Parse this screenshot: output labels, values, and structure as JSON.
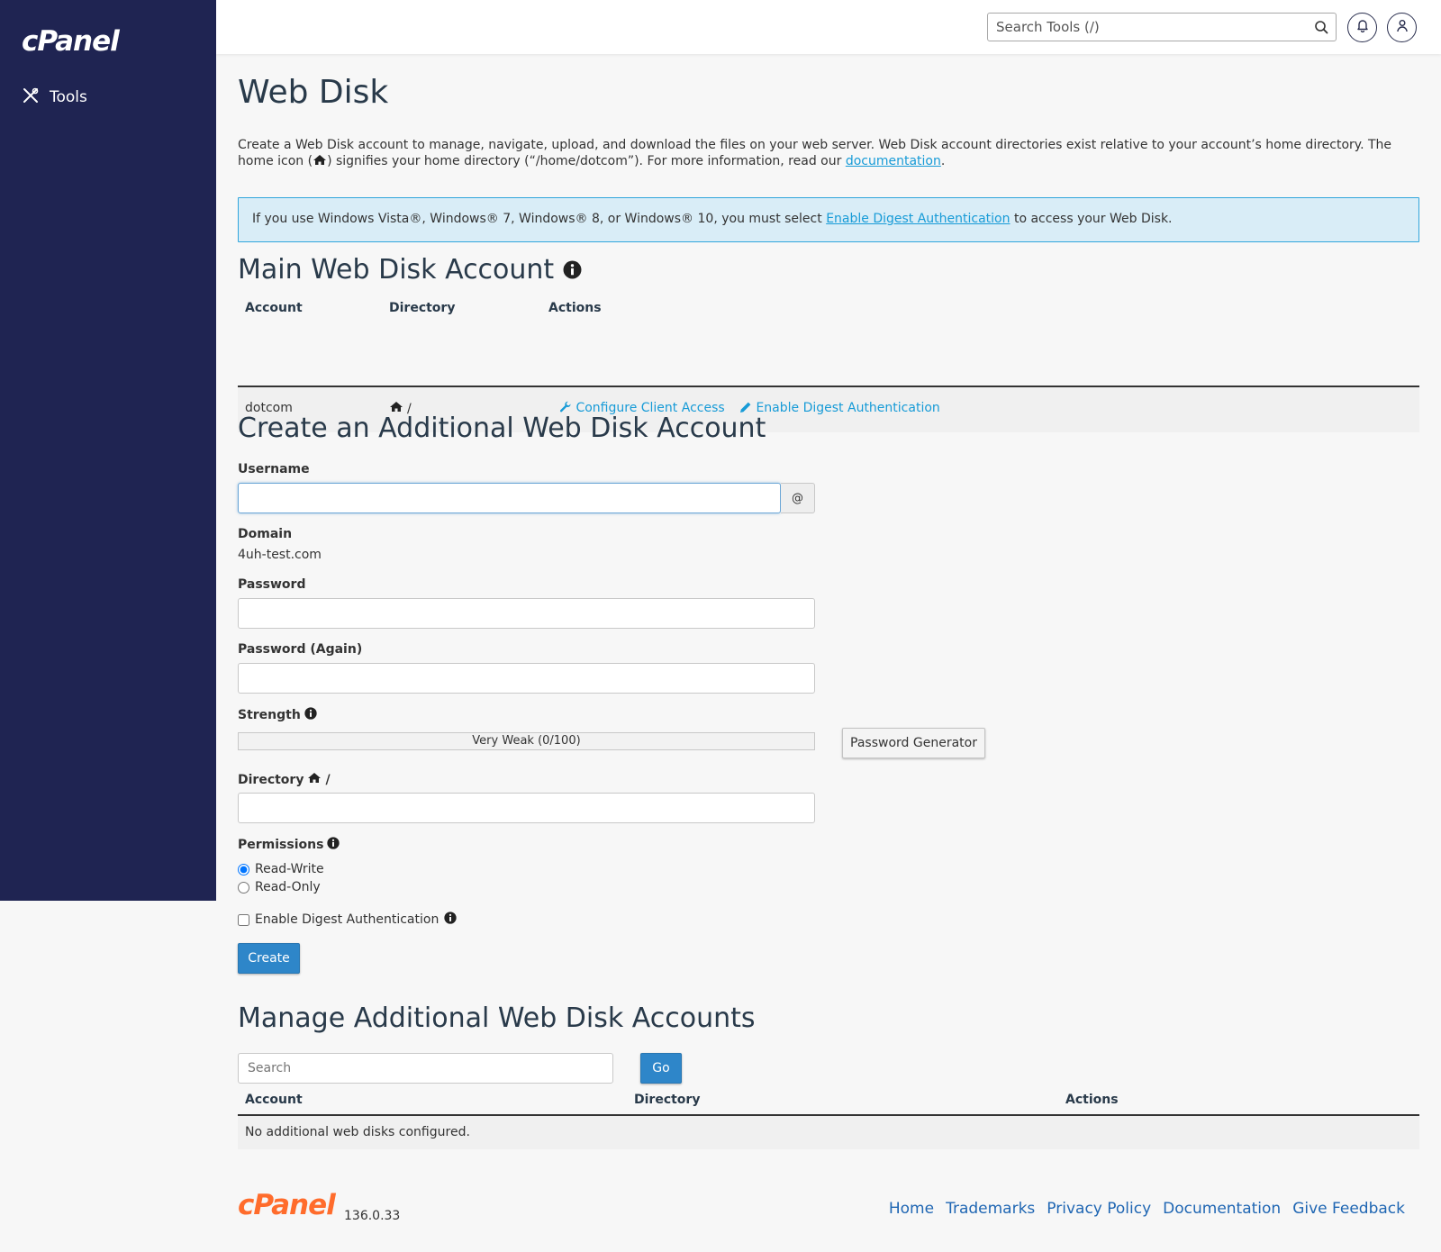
{
  "brand": {
    "logo_text": "cPanel"
  },
  "sidebar": {
    "items": [
      {
        "label": "Tools",
        "icon": "tools-icon"
      }
    ]
  },
  "header": {
    "search_placeholder": "Search Tools (/)"
  },
  "page": {
    "title": "Web Disk",
    "intro_part1": "Create a Web Disk account to manage, navigate, upload, and download the files on your web server. Web Disk account directories exist relative to your account’s home directory. The home icon (",
    "intro_part2": ") signifies your home directory (“/home/dotcom”). For more information, read our ",
    "intro_link": "documentation",
    "intro_end": "."
  },
  "alert": {
    "text_before": "If you use Windows Vista®, Windows® 7, Windows® 8, or Windows® 10, you must select ",
    "link": "Enable Digest Authentication",
    "text_after": " to access your Web Disk."
  },
  "main_account": {
    "heading": "Main Web Disk Account",
    "columns": [
      "Account",
      "Directory",
      "Actions"
    ],
    "row": {
      "account": "dotcom",
      "directory": "/",
      "action_configure": "Configure Client Access",
      "action_digest": "Enable Digest Authentication"
    }
  },
  "create": {
    "heading": "Create an Additional Web Disk Account",
    "username_label": "Username",
    "username_value": "",
    "at_symbol": "@",
    "domain_label": "Domain",
    "domain_value": "4uh-test.com",
    "password_label": "Password",
    "password_again_label": "Password (Again)",
    "strength_label": "Strength",
    "strength_text": "Very Weak (0/100)",
    "strength_value": 0,
    "password_generator": "Password Generator",
    "directory_label": "Directory",
    "directory_suffix": "/",
    "permissions_label": "Permissions",
    "perm_rw": "Read-Write",
    "perm_ro": "Read-Only",
    "digest_label": "Enable Digest Authentication",
    "create_button": "Create"
  },
  "manage": {
    "heading": "Manage Additional Web Disk Accounts",
    "search_placeholder": "Search",
    "go_button": "Go",
    "columns": [
      "Account",
      "Directory",
      "Actions"
    ],
    "empty_text": "No additional web disks configured."
  },
  "footer": {
    "logo_text": "cPanel",
    "version": "136.0.33",
    "links": [
      "Home",
      "Trademarks",
      "Privacy Policy",
      "Documentation",
      "Give Feedback"
    ]
  },
  "colors": {
    "sidebar_bg": "#1f2452",
    "link": "#179bd7",
    "primary_button": "#2e86c9",
    "footer_logo": "#ff6c2c"
  }
}
